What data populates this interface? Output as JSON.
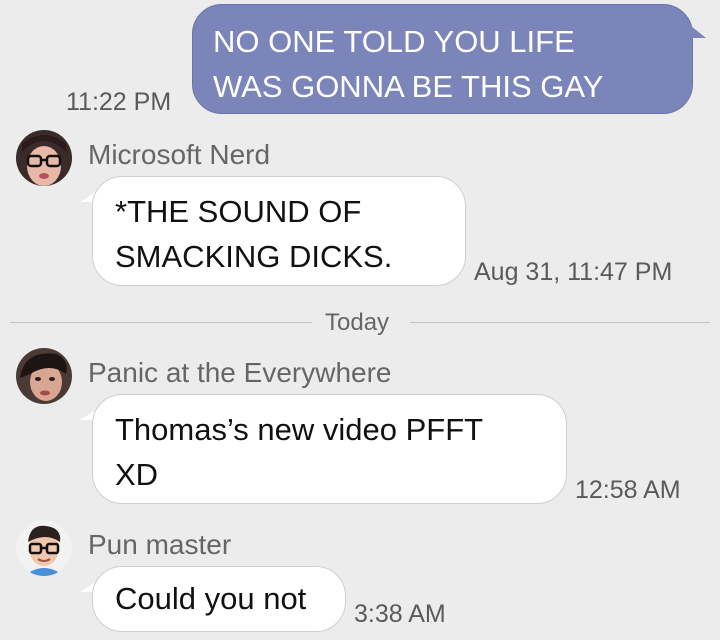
{
  "messages": [
    {
      "direction": "outgoing",
      "text_lines": [
        "NO ONE TOLD YOU LIFE",
        "WAS GONNA BE THIS GAY"
      ],
      "time": "11:22 PM"
    },
    {
      "direction": "incoming",
      "sender": "Microsoft Nerd",
      "text_lines": [
        "*THE SOUND OF",
        "SMACKING DICKS."
      ],
      "time": "Aug 31, 11:47 PM"
    },
    {
      "direction": "incoming",
      "sender": "Panic at the Everywhere",
      "text_lines": [
        "Thomas’s new video PFFT",
        "XD"
      ],
      "time": "12:58 AM"
    },
    {
      "direction": "incoming",
      "sender": "Pun master",
      "text_lines": [
        "Could you not"
      ],
      "time": "3:38 AM"
    }
  ],
  "divider": {
    "label": "Today"
  },
  "colors": {
    "background": "#ececec",
    "outgoing_bubble": "#7b85b9",
    "incoming_bubble": "#ffffff"
  }
}
